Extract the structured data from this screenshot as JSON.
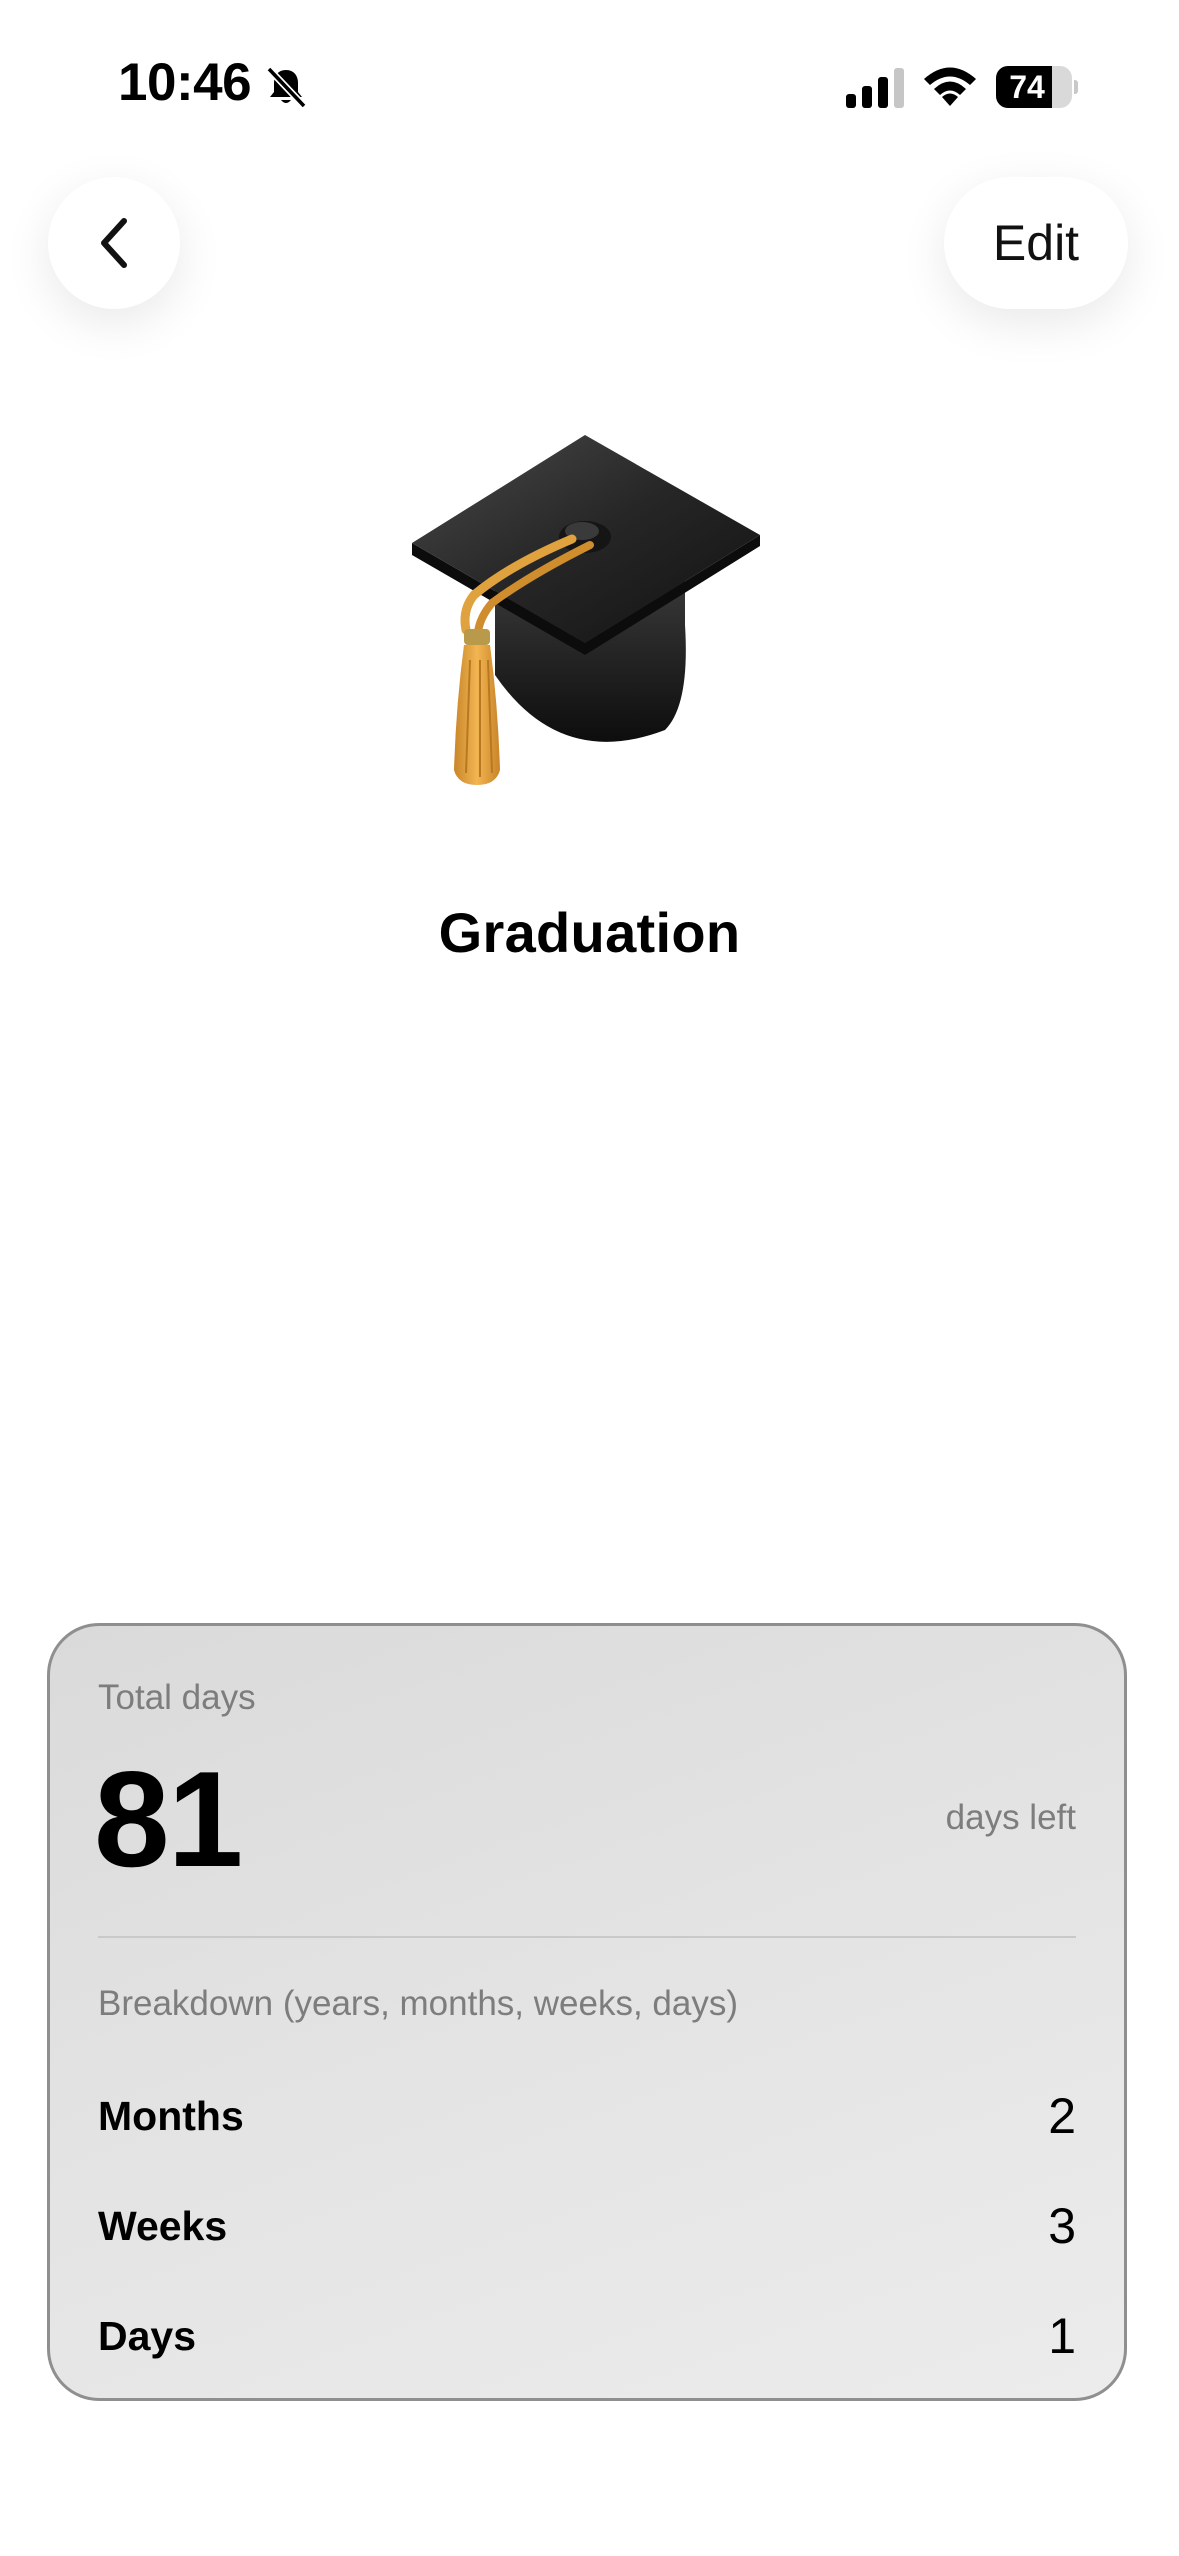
{
  "status_bar": {
    "time": "10:46",
    "battery": "74",
    "battery_level": 0.74,
    "icons": [
      "bell-off-icon",
      "cellular-signal-icon",
      "wifi-icon",
      "battery-icon"
    ]
  },
  "nav": {
    "back_icon": "chevron-left-icon",
    "edit_label": "Edit"
  },
  "event": {
    "emoji": "graduation-cap-icon",
    "title": "Graduation"
  },
  "card": {
    "total_label": "Total days",
    "days_value": "81",
    "days_left_label": "days left",
    "breakdown_label": "Breakdown (years, months, weeks, days)",
    "rows": [
      {
        "label": "Months",
        "value": "2"
      },
      {
        "label": "Weeks",
        "value": "3"
      },
      {
        "label": "Days",
        "value": "1"
      }
    ]
  },
  "colors": {
    "card_border": "#8f8f8f",
    "muted_text": "#7d7d7d",
    "tassel": "#e3a341",
    "cap": "#1f1f1f"
  }
}
